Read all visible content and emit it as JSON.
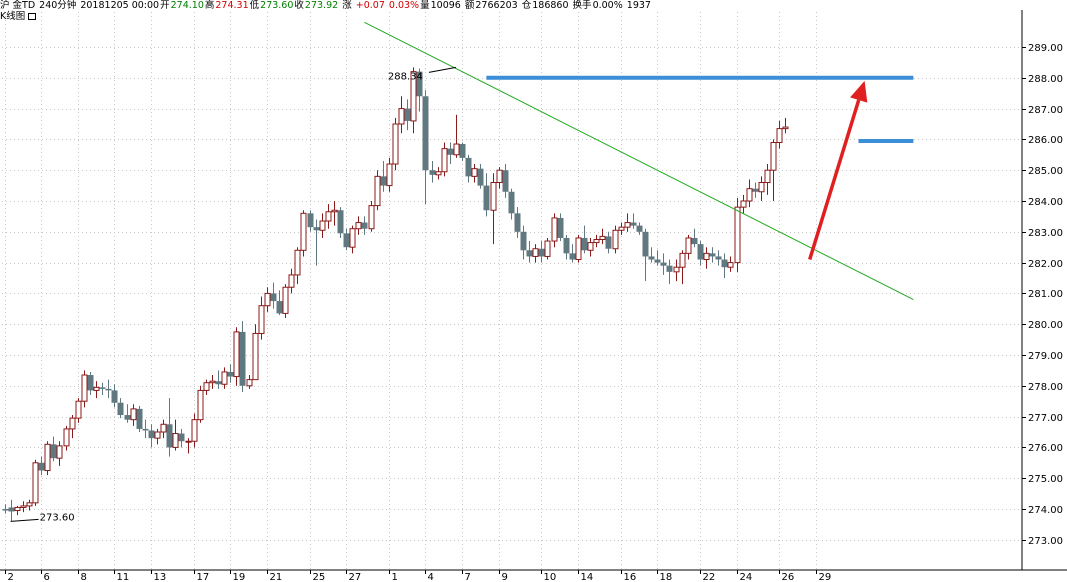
{
  "header": {
    "symbol": "沪  金TD",
    "period": "240分钟",
    "datetime": "20181205 00:00",
    "open_label": "开",
    "open": "274.10",
    "high_label": "高",
    "high": "274.31",
    "low_label": "低",
    "low": "273.60",
    "close_label": "收",
    "close": "273.92",
    "change_label": "涨",
    "change": "+0.07",
    "change_pct": "0.03%",
    "volume_label": "量",
    "volume": "10096",
    "amount_label": "额",
    "amount": "2766203",
    "oi_label": "仓",
    "open_interest": "186860",
    "turnover_label": "换手",
    "turnover": "0.00%",
    "extra": "1937"
  },
  "sublabel": "K线图",
  "colors": {
    "up": "#8b1a1a",
    "down": "#607880",
    "trendline": "#22aa22",
    "level": "#3b8fd8",
    "arrow": "#e02020",
    "grid": "#c8c8c8"
  },
  "chart_data": {
    "type": "candlestick",
    "ylim": [
      272.4,
      289.7
    ],
    "y_ticks": [
      "273.00",
      "274.00",
      "275.00",
      "276.00",
      "277.00",
      "278.00",
      "279.00",
      "280.00",
      "281.00",
      "282.00",
      "283.00",
      "284.00",
      "285.00",
      "286.00",
      "287.00",
      "288.00",
      "289.00"
    ],
    "x_tick_labels": [
      "2",
      "6",
      "8",
      "11",
      "13",
      "17",
      "19",
      "21",
      "25",
      "27",
      "1",
      "4",
      "7",
      "9",
      "10",
      "14",
      "16",
      "18",
      "22",
      "24",
      "26",
      "29"
    ],
    "x_tick_bar_index": [
      0,
      6,
      12,
      18,
      24,
      31,
      37,
      43,
      50,
      56,
      63,
      69,
      75,
      81,
      88,
      94,
      101,
      107,
      114,
      120,
      127,
      133
    ],
    "annotations": [
      {
        "text": "288.34",
        "bar_index": 74,
        "value": 288.34
      },
      {
        "text": "273.60",
        "bar_index": 1,
        "value": 273.6
      }
    ],
    "trendline": [
      {
        "bar_index": 59,
        "value": 289.8
      },
      {
        "bar_index": 149,
        "value": 280.8
      }
    ],
    "levels": [
      {
        "value": 288.0,
        "from_bar": 79,
        "to_bar": 149
      },
      {
        "value": 285.95,
        "from_bar": 140,
        "to_bar": 149
      }
    ],
    "arrow": {
      "from_bar": 132,
      "from_value": 282.1,
      "to_bar": 141,
      "to_value": 287.9
    },
    "ohlc": [
      [
        274.0,
        274.15,
        273.85,
        273.95
      ],
      [
        274.05,
        274.3,
        273.6,
        273.92
      ],
      [
        273.95,
        274.1,
        273.8,
        274.05
      ],
      [
        274.05,
        274.25,
        273.9,
        274.1
      ],
      [
        274.1,
        274.3,
        273.95,
        274.2
      ],
      [
        274.2,
        275.6,
        274.1,
        275.5
      ],
      [
        275.5,
        275.7,
        275.1,
        275.25
      ],
      [
        275.25,
        276.2,
        275.1,
        276.1
      ],
      [
        276.1,
        276.35,
        275.55,
        275.65
      ],
      [
        275.65,
        276.2,
        275.4,
        276.05
      ],
      [
        276.05,
        276.7,
        275.9,
        276.6
      ],
      [
        276.6,
        277.05,
        276.3,
        276.95
      ],
      [
        276.95,
        277.6,
        276.8,
        277.5
      ],
      [
        277.5,
        278.5,
        277.3,
        278.35
      ],
      [
        278.35,
        278.45,
        277.7,
        277.85
      ],
      [
        277.85,
        278.15,
        277.6,
        277.95
      ],
      [
        277.95,
        278.1,
        277.7,
        277.9
      ],
      [
        277.9,
        278.2,
        277.6,
        277.85
      ],
      [
        277.85,
        278.05,
        277.3,
        277.45
      ],
      [
        277.45,
        277.6,
        276.95,
        277.05
      ],
      [
        277.05,
        277.4,
        276.8,
        276.9
      ],
      [
        276.9,
        277.4,
        276.7,
        277.25
      ],
      [
        277.25,
        277.35,
        276.5,
        276.6
      ],
      [
        276.6,
        276.9,
        276.3,
        276.55
      ],
      [
        276.55,
        276.75,
        276.0,
        276.3
      ],
      [
        276.3,
        276.6,
        276.1,
        276.5
      ],
      [
        276.5,
        276.9,
        276.3,
        276.75
      ],
      [
        276.75,
        277.6,
        275.7,
        276.0
      ],
      [
        276.0,
        276.9,
        275.9,
        276.45
      ],
      [
        276.45,
        276.6,
        276.0,
        276.2
      ],
      [
        276.2,
        276.3,
        275.8,
        276.2
      ],
      [
        276.2,
        277.1,
        276.0,
        276.9
      ],
      [
        276.9,
        278.0,
        276.8,
        277.85
      ],
      [
        277.85,
        278.2,
        277.7,
        278.1
      ],
      [
        278.1,
        278.35,
        277.9,
        278.15
      ],
      [
        278.15,
        278.5,
        277.9,
        278.05
      ],
      [
        278.05,
        278.6,
        277.9,
        278.45
      ],
      [
        278.45,
        278.7,
        278.1,
        278.3
      ],
      [
        278.3,
        279.9,
        278.0,
        279.75
      ],
      [
        279.75,
        280.1,
        277.8,
        278.0
      ],
      [
        278.0,
        278.35,
        277.9,
        278.2
      ],
      [
        278.2,
        280.0,
        279.0,
        279.7
      ],
      [
        279.7,
        280.9,
        279.5,
        280.6
      ],
      [
        280.6,
        281.2,
        280.4,
        281.0
      ],
      [
        281.0,
        281.35,
        280.5,
        280.75
      ],
      [
        280.75,
        281.1,
        280.3,
        280.35
      ],
      [
        280.35,
        281.3,
        280.2,
        281.2
      ],
      [
        281.2,
        281.8,
        281.0,
        281.6
      ],
      [
        281.6,
        282.5,
        281.3,
        282.4
      ],
      [
        282.4,
        283.7,
        282.2,
        283.6
      ],
      [
        283.6,
        283.7,
        283.0,
        283.15
      ],
      [
        283.15,
        283.4,
        281.9,
        283.05
      ],
      [
        283.05,
        283.6,
        282.8,
        283.35
      ],
      [
        283.35,
        283.9,
        283.1,
        283.65
      ],
      [
        283.65,
        284.0,
        283.2,
        283.7
      ],
      [
        283.7,
        283.8,
        282.8,
        282.95
      ],
      [
        282.95,
        283.1,
        282.4,
        282.5
      ],
      [
        282.5,
        283.2,
        282.3,
        283.1
      ],
      [
        283.1,
        283.5,
        282.9,
        283.3
      ],
      [
        283.3,
        283.5,
        282.9,
        283.1
      ],
      [
        283.1,
        284.0,
        283.0,
        283.85
      ],
      [
        283.85,
        285.0,
        283.7,
        284.8
      ],
      [
        284.8,
        285.3,
        284.3,
        284.5
      ],
      [
        284.5,
        285.4,
        284.3,
        285.2
      ],
      [
        285.2,
        286.7,
        285.0,
        286.5
      ],
      [
        286.5,
        287.4,
        286.2,
        287.0
      ],
      [
        287.0,
        287.3,
        286.3,
        286.6
      ],
      [
        286.6,
        288.34,
        286.2,
        288.2
      ],
      [
        288.2,
        288.3,
        286.9,
        287.4
      ],
      [
        287.4,
        287.6,
        283.9,
        285.0
      ],
      [
        285.0,
        285.3,
        284.6,
        284.85
      ],
      [
        284.85,
        285.1,
        284.7,
        284.95
      ],
      [
        284.95,
        285.9,
        284.8,
        285.7
      ],
      [
        285.7,
        285.9,
        285.2,
        285.5
      ],
      [
        285.5,
        286.8,
        285.4,
        285.85
      ],
      [
        285.85,
        285.9,
        285.3,
        285.4
      ],
      [
        285.4,
        285.5,
        284.6,
        284.8
      ],
      [
        284.8,
        285.2,
        284.6,
        285.05
      ],
      [
        285.05,
        285.2,
        284.4,
        284.5
      ],
      [
        284.5,
        284.9,
        283.5,
        283.7
      ],
      [
        283.7,
        284.9,
        282.6,
        284.6
      ],
      [
        284.6,
        285.1,
        284.4,
        285.0
      ],
      [
        285.0,
        285.2,
        284.1,
        284.3
      ],
      [
        284.3,
        284.4,
        283.4,
        283.6
      ],
      [
        283.6,
        283.8,
        282.8,
        283.0
      ],
      [
        283.0,
        283.2,
        282.1,
        282.4
      ],
      [
        282.4,
        282.7,
        282.0,
        282.2
      ],
      [
        282.2,
        282.6,
        282.0,
        282.45
      ],
      [
        282.45,
        282.7,
        282.0,
        282.2
      ],
      [
        282.2,
        282.8,
        282.1,
        282.7
      ],
      [
        282.7,
        283.6,
        282.5,
        283.45
      ],
      [
        283.45,
        283.6,
        282.7,
        282.8
      ],
      [
        282.8,
        282.9,
        282.1,
        282.3
      ],
      [
        282.3,
        282.6,
        282.0,
        282.1
      ],
      [
        282.1,
        282.9,
        282.0,
        282.8
      ],
      [
        282.8,
        283.2,
        282.3,
        282.4
      ],
      [
        282.4,
        282.8,
        282.2,
        282.65
      ],
      [
        282.65,
        282.9,
        282.5,
        282.75
      ],
      [
        282.75,
        283.1,
        282.6,
        282.85
      ],
      [
        282.85,
        283.0,
        282.3,
        282.45
      ],
      [
        282.45,
        283.2,
        282.3,
        283.05
      ],
      [
        283.05,
        283.3,
        282.9,
        283.15
      ],
      [
        283.15,
        283.6,
        283.0,
        283.3
      ],
      [
        283.3,
        283.6,
        283.1,
        283.2
      ],
      [
        283.2,
        283.3,
        282.9,
        283.0
      ],
      [
        283.0,
        283.1,
        281.4,
        282.2
      ],
      [
        282.2,
        282.5,
        282.0,
        282.1
      ],
      [
        282.1,
        282.4,
        281.9,
        282.0
      ],
      [
        282.0,
        282.3,
        281.6,
        281.9
      ],
      [
        281.9,
        282.1,
        281.3,
        281.7
      ],
      [
        281.7,
        282.1,
        281.4,
        281.85
      ],
      [
        281.85,
        282.4,
        281.3,
        282.3
      ],
      [
        282.3,
        282.9,
        282.1,
        282.8
      ],
      [
        282.8,
        283.1,
        282.5,
        282.6
      ],
      [
        282.6,
        282.7,
        281.9,
        282.1
      ],
      [
        282.1,
        282.5,
        281.8,
        282.3
      ],
      [
        282.3,
        282.5,
        282.0,
        282.2
      ],
      [
        282.2,
        282.4,
        281.9,
        282.1
      ],
      [
        282.1,
        282.3,
        281.5,
        281.85
      ],
      [
        281.85,
        282.2,
        281.7,
        282.0
      ],
      [
        282.0,
        284.1,
        281.7,
        283.8
      ],
      [
        283.8,
        284.2,
        283.6,
        284.0
      ],
      [
        284.0,
        284.7,
        283.8,
        284.4
      ],
      [
        284.4,
        284.6,
        284.1,
        284.3
      ],
      [
        284.3,
        284.8,
        284.0,
        284.6
      ],
      [
        284.6,
        285.2,
        284.2,
        285.0
      ],
      [
        285.0,
        286.0,
        284.0,
        285.9
      ],
      [
        285.9,
        286.6,
        285.7,
        286.35
      ],
      [
        286.35,
        286.7,
        286.2,
        286.4
      ]
    ]
  }
}
